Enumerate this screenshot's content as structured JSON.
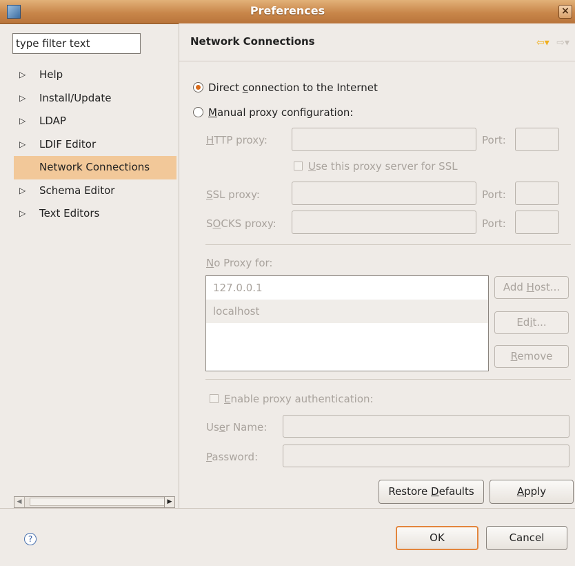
{
  "window": {
    "title": "Preferences"
  },
  "filter": {
    "placeholder": "type filter text",
    "value": "type filter text"
  },
  "tree": {
    "items": [
      {
        "label": "Help",
        "expandable": true
      },
      {
        "label": "Install/Update",
        "expandable": true
      },
      {
        "label": "LDAP",
        "expandable": true
      },
      {
        "label": "LDIF Editor",
        "expandable": true
      },
      {
        "label": "Network Connections",
        "expandable": false,
        "selected": true
      },
      {
        "label": "Schema Editor",
        "expandable": true
      },
      {
        "label": "Text Editors",
        "expandable": true
      }
    ]
  },
  "page": {
    "title": "Network Connections"
  },
  "radios": {
    "direct": {
      "pre": "Direct ",
      "mnemonic": "c",
      "post": "onnection to the Internet",
      "selected": true
    },
    "manual": {
      "pre": "",
      "mnemonic": "M",
      "post": "anual proxy configuration:",
      "selected": false
    }
  },
  "proxy": {
    "http": {
      "pre": "",
      "mnemonic": "H",
      "post": "TTP proxy:",
      "port_label": "Port:"
    },
    "ssl_checkbox": {
      "pre": "",
      "mnemonic": "U",
      "post": "se this proxy server for SSL"
    },
    "ssl": {
      "pre": "",
      "mnemonic": "S",
      "post": "SL proxy:",
      "port_label": "Port:"
    },
    "socks": {
      "pre": "S",
      "mnemonic": "O",
      "post": "CKS proxy:",
      "port_label": "Port:"
    }
  },
  "no_proxy": {
    "label_pre": "",
    "label_mnemonic": "N",
    "label_post": "o Proxy for:",
    "hosts": [
      "127.0.0.1",
      "localhost"
    ],
    "add_host": {
      "pre": "Add ",
      "mnemonic": "H",
      "post": "ost..."
    },
    "edit": {
      "pre": "Ed",
      "mnemonic": "i",
      "post": "t..."
    },
    "remove": {
      "pre": "",
      "mnemonic": "R",
      "post": "emove"
    }
  },
  "auth": {
    "enable": {
      "pre": "",
      "mnemonic": "E",
      "post": "nable proxy authentication:"
    },
    "user": {
      "pre": "Us",
      "mnemonic": "e",
      "post": "r Name:"
    },
    "password": {
      "pre": "",
      "mnemonic": "P",
      "post": "assword:"
    }
  },
  "buttons": {
    "restore_defaults": {
      "pre": "Restore ",
      "mnemonic": "D",
      "post": "efaults"
    },
    "apply": {
      "pre": "",
      "mnemonic": "A",
      "post": "pply"
    },
    "ok": "OK",
    "cancel": "Cancel"
  },
  "icons": {
    "help": "help-icon",
    "back": "back-arrow-icon",
    "forward": "forward-arrow-icon",
    "app": "app-icon",
    "close": "close-icon"
  },
  "colors": {
    "titlebar": "#c8864a",
    "selection": "#f2c899",
    "default_button_border": "#e3853c",
    "radio_dot": "#d96b1b"
  }
}
